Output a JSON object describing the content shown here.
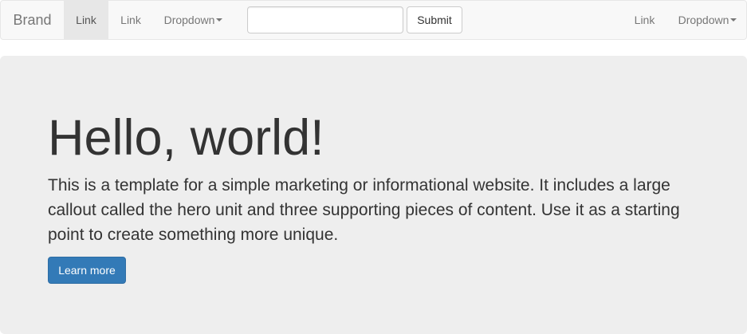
{
  "navbar": {
    "brand": "Brand",
    "left_links": [
      {
        "label": "Link",
        "active": true
      },
      {
        "label": "Link",
        "active": false
      }
    ],
    "left_dropdown": "Dropdown",
    "search": {
      "value": "",
      "placeholder": ""
    },
    "submit_label": "Submit",
    "right_link": "Link",
    "right_dropdown": "Dropdown"
  },
  "hero": {
    "title": "Hello, world!",
    "text": "This is a template for a simple marketing or informational website. It includes a large callout called the hero unit and three supporting pieces of content. Use it as a starting point to create something more unique.",
    "button_label": "Learn more"
  },
  "colors": {
    "navbar_bg": "#f8f8f8",
    "active_link_bg": "#e7e7e7",
    "jumbotron_bg": "#eeeeee",
    "primary": "#337ab7"
  }
}
